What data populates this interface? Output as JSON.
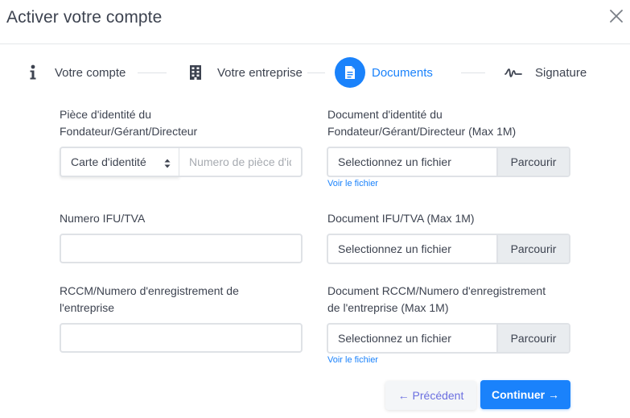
{
  "header": {
    "title": "Activer votre compte",
    "close_icon": "close-icon"
  },
  "stepper": {
    "steps": [
      {
        "label": "Votre compte",
        "icon": "info-icon",
        "active": false
      },
      {
        "label": "Votre entreprise",
        "icon": "building-icon",
        "active": false
      },
      {
        "label": "Documents",
        "icon": "document-icon",
        "active": true
      },
      {
        "label": "Signature",
        "icon": "signature-icon",
        "active": false
      }
    ]
  },
  "form": {
    "id_piece": {
      "label_line1": "Pièce d'identité du",
      "label_line2": "Fondateur/Gérant/Directeur",
      "select_value": "Carte d'identité",
      "number_placeholder": "Numero de pièce d'identité",
      "number_value": ""
    },
    "id_document": {
      "label_line1": "Document d'identité du",
      "label_line2": "Fondateur/Gérant/Directeur (Max 1M)",
      "file_text": "Selectionnez un fichier",
      "browse_label": "Parcourir",
      "view_link": "Voir le fichier"
    },
    "ifu": {
      "label": "Numero IFU/TVA",
      "value": ""
    },
    "ifu_document": {
      "label": "Document IFU/TVA (Max 1M)",
      "file_text": "Selectionnez un fichier",
      "browse_label": "Parcourir"
    },
    "rccm": {
      "label_line1": "RCCM/Numero d'enregistrement de",
      "label_line2": "l'entreprise",
      "value": ""
    },
    "rccm_document": {
      "label_line1": "Document RCCM/Numero d'enregistrement",
      "label_line2": "de l'entreprise (Max 1M)",
      "file_text": "Selectionnez un fichier",
      "browse_label": "Parcourir",
      "view_link": "Voir le fichier"
    }
  },
  "actions": {
    "previous_label": "← Précédent",
    "continue_label": "Continuer →"
  },
  "colors": {
    "accent": "#1a82fb",
    "previous_text": "#6b6fe0"
  }
}
